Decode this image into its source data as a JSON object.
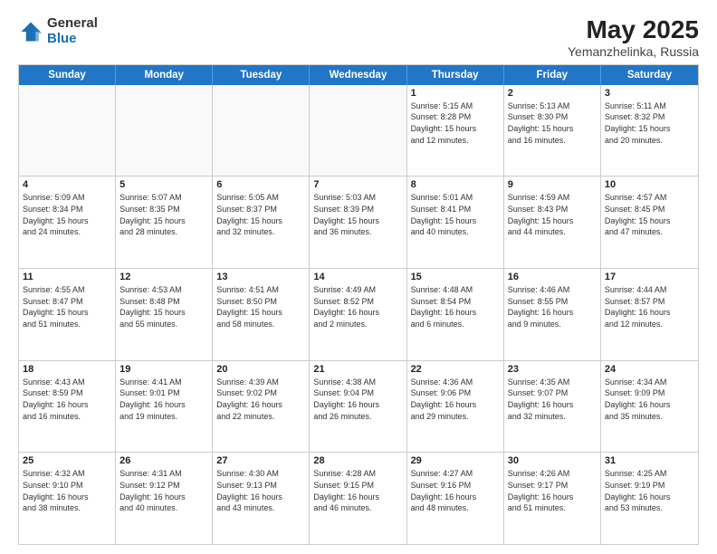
{
  "logo": {
    "general": "General",
    "blue": "Blue"
  },
  "title": "May 2025",
  "location": "Yemanzhelinka, Russia",
  "headers": [
    "Sunday",
    "Monday",
    "Tuesday",
    "Wednesday",
    "Thursday",
    "Friday",
    "Saturday"
  ],
  "rows": [
    [
      {
        "day": "",
        "info": ""
      },
      {
        "day": "",
        "info": ""
      },
      {
        "day": "",
        "info": ""
      },
      {
        "day": "",
        "info": ""
      },
      {
        "day": "1",
        "info": "Sunrise: 5:15 AM\nSunset: 8:28 PM\nDaylight: 15 hours\nand 12 minutes."
      },
      {
        "day": "2",
        "info": "Sunrise: 5:13 AM\nSunset: 8:30 PM\nDaylight: 15 hours\nand 16 minutes."
      },
      {
        "day": "3",
        "info": "Sunrise: 5:11 AM\nSunset: 8:32 PM\nDaylight: 15 hours\nand 20 minutes."
      }
    ],
    [
      {
        "day": "4",
        "info": "Sunrise: 5:09 AM\nSunset: 8:34 PM\nDaylight: 15 hours\nand 24 minutes."
      },
      {
        "day": "5",
        "info": "Sunrise: 5:07 AM\nSunset: 8:35 PM\nDaylight: 15 hours\nand 28 minutes."
      },
      {
        "day": "6",
        "info": "Sunrise: 5:05 AM\nSunset: 8:37 PM\nDaylight: 15 hours\nand 32 minutes."
      },
      {
        "day": "7",
        "info": "Sunrise: 5:03 AM\nSunset: 8:39 PM\nDaylight: 15 hours\nand 36 minutes."
      },
      {
        "day": "8",
        "info": "Sunrise: 5:01 AM\nSunset: 8:41 PM\nDaylight: 15 hours\nand 40 minutes."
      },
      {
        "day": "9",
        "info": "Sunrise: 4:59 AM\nSunset: 8:43 PM\nDaylight: 15 hours\nand 44 minutes."
      },
      {
        "day": "10",
        "info": "Sunrise: 4:57 AM\nSunset: 8:45 PM\nDaylight: 15 hours\nand 47 minutes."
      }
    ],
    [
      {
        "day": "11",
        "info": "Sunrise: 4:55 AM\nSunset: 8:47 PM\nDaylight: 15 hours\nand 51 minutes."
      },
      {
        "day": "12",
        "info": "Sunrise: 4:53 AM\nSunset: 8:48 PM\nDaylight: 15 hours\nand 55 minutes."
      },
      {
        "day": "13",
        "info": "Sunrise: 4:51 AM\nSunset: 8:50 PM\nDaylight: 15 hours\nand 58 minutes."
      },
      {
        "day": "14",
        "info": "Sunrise: 4:49 AM\nSunset: 8:52 PM\nDaylight: 16 hours\nand 2 minutes."
      },
      {
        "day": "15",
        "info": "Sunrise: 4:48 AM\nSunset: 8:54 PM\nDaylight: 16 hours\nand 6 minutes."
      },
      {
        "day": "16",
        "info": "Sunrise: 4:46 AM\nSunset: 8:55 PM\nDaylight: 16 hours\nand 9 minutes."
      },
      {
        "day": "17",
        "info": "Sunrise: 4:44 AM\nSunset: 8:57 PM\nDaylight: 16 hours\nand 12 minutes."
      }
    ],
    [
      {
        "day": "18",
        "info": "Sunrise: 4:43 AM\nSunset: 8:59 PM\nDaylight: 16 hours\nand 16 minutes."
      },
      {
        "day": "19",
        "info": "Sunrise: 4:41 AM\nSunset: 9:01 PM\nDaylight: 16 hours\nand 19 minutes."
      },
      {
        "day": "20",
        "info": "Sunrise: 4:39 AM\nSunset: 9:02 PM\nDaylight: 16 hours\nand 22 minutes."
      },
      {
        "day": "21",
        "info": "Sunrise: 4:38 AM\nSunset: 9:04 PM\nDaylight: 16 hours\nand 26 minutes."
      },
      {
        "day": "22",
        "info": "Sunrise: 4:36 AM\nSunset: 9:06 PM\nDaylight: 16 hours\nand 29 minutes."
      },
      {
        "day": "23",
        "info": "Sunrise: 4:35 AM\nSunset: 9:07 PM\nDaylight: 16 hours\nand 32 minutes."
      },
      {
        "day": "24",
        "info": "Sunrise: 4:34 AM\nSunset: 9:09 PM\nDaylight: 16 hours\nand 35 minutes."
      }
    ],
    [
      {
        "day": "25",
        "info": "Sunrise: 4:32 AM\nSunset: 9:10 PM\nDaylight: 16 hours\nand 38 minutes."
      },
      {
        "day": "26",
        "info": "Sunrise: 4:31 AM\nSunset: 9:12 PM\nDaylight: 16 hours\nand 40 minutes."
      },
      {
        "day": "27",
        "info": "Sunrise: 4:30 AM\nSunset: 9:13 PM\nDaylight: 16 hours\nand 43 minutes."
      },
      {
        "day": "28",
        "info": "Sunrise: 4:28 AM\nSunset: 9:15 PM\nDaylight: 16 hours\nand 46 minutes."
      },
      {
        "day": "29",
        "info": "Sunrise: 4:27 AM\nSunset: 9:16 PM\nDaylight: 16 hours\nand 48 minutes."
      },
      {
        "day": "30",
        "info": "Sunrise: 4:26 AM\nSunset: 9:17 PM\nDaylight: 16 hours\nand 51 minutes."
      },
      {
        "day": "31",
        "info": "Sunrise: 4:25 AM\nSunset: 9:19 PM\nDaylight: 16 hours\nand 53 minutes."
      }
    ]
  ]
}
